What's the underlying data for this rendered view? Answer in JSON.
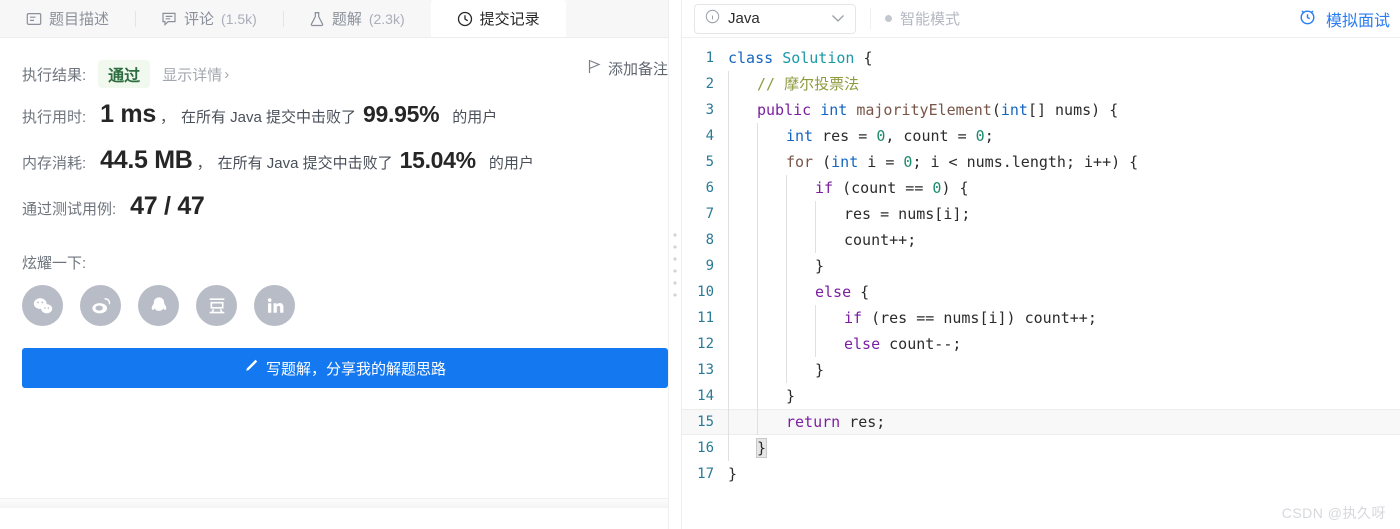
{
  "tabs": [
    {
      "label": "题目描述",
      "count": "",
      "icon": "description-icon",
      "active": false
    },
    {
      "label": "评论",
      "count": "(1.5k)",
      "icon": "comment-icon",
      "active": false
    },
    {
      "label": "题解",
      "count": "(2.3k)",
      "icon": "flask-icon",
      "active": false
    },
    {
      "label": "提交记录",
      "count": "",
      "icon": "clock-icon",
      "active": true
    }
  ],
  "result": {
    "label": "执行结果:",
    "status": "通过",
    "details_link": "显示详情",
    "details_chevron": "›",
    "note_button": "添加备注"
  },
  "runtime": {
    "label": "执行用时:",
    "value": "1 ms",
    "comma": "，",
    "prefix": "在所有 Java 提交中击败了",
    "percent": "99.95%",
    "suffix": "的用户"
  },
  "memory": {
    "label": "内存消耗:",
    "value": "44.5 MB",
    "comma": "，",
    "prefix": "在所有 Java 提交中击败了",
    "percent": "15.04%",
    "suffix": "的用户"
  },
  "testcases": {
    "label": "通过测试用例:",
    "value": "47 / 47"
  },
  "share": {
    "label": "炫耀一下:",
    "items": [
      {
        "name": "wechat-share-icon",
        "glyph": "微"
      },
      {
        "name": "weibo-share-icon",
        "glyph": "博"
      },
      {
        "name": "qq-share-icon",
        "glyph": "Q"
      },
      {
        "name": "douban-share-icon",
        "glyph": "豆"
      },
      {
        "name": "linkedin-share-icon",
        "glyph": "in"
      }
    ]
  },
  "write_solution_button": "写题解，分享我的解题思路",
  "editor": {
    "language": "Java",
    "smart_mode": "智能模式",
    "mock_interview": "模拟面试",
    "chevron": "⌄",
    "active_line": 15,
    "lines": [
      {
        "n": "1",
        "indent": 0,
        "tokens": [
          {
            "t": "class ",
            "c": "kw2"
          },
          {
            "t": "Solution",
            "c": "typ"
          },
          {
            "t": " {",
            "c": "plain"
          }
        ]
      },
      {
        "n": "2",
        "indent": 1,
        "tokens": [
          {
            "t": "// 摩尔投票法",
            "c": "cmt"
          }
        ]
      },
      {
        "n": "3",
        "indent": 1,
        "tokens": [
          {
            "t": "public",
            "c": "kw"
          },
          {
            "t": " ",
            "c": "plain"
          },
          {
            "t": "int",
            "c": "kw2"
          },
          {
            "t": " ",
            "c": "plain"
          },
          {
            "t": "majorityElement",
            "c": "fn"
          },
          {
            "t": "(",
            "c": "plain"
          },
          {
            "t": "int",
            "c": "kw2"
          },
          {
            "t": "[] nums) ",
            "c": "plain"
          },
          {
            "t": "{",
            "c": "plain"
          }
        ]
      },
      {
        "n": "4",
        "indent": 2,
        "tokens": [
          {
            "t": "int",
            "c": "kw2"
          },
          {
            "t": " res = ",
            "c": "plain"
          },
          {
            "t": "0",
            "c": "num"
          },
          {
            "t": ", count = ",
            "c": "plain"
          },
          {
            "t": "0",
            "c": "num"
          },
          {
            "t": ";",
            "c": "plain"
          }
        ]
      },
      {
        "n": "5",
        "indent": 2,
        "tokens": [
          {
            "t": "for",
            "c": "fn"
          },
          {
            "t": " (",
            "c": "plain"
          },
          {
            "t": "int",
            "c": "kw2"
          },
          {
            "t": " i = ",
            "c": "plain"
          },
          {
            "t": "0",
            "c": "num"
          },
          {
            "t": "; i < nums.length; i++) {",
            "c": "plain"
          }
        ]
      },
      {
        "n": "6",
        "indent": 3,
        "tokens": [
          {
            "t": "if",
            "c": "kw"
          },
          {
            "t": " (count == ",
            "c": "plain"
          },
          {
            "t": "0",
            "c": "num"
          },
          {
            "t": ") {",
            "c": "plain"
          }
        ]
      },
      {
        "n": "7",
        "indent": 4,
        "tokens": [
          {
            "t": "res = nums[i];",
            "c": "plain"
          }
        ]
      },
      {
        "n": "8",
        "indent": 4,
        "tokens": [
          {
            "t": "count++;",
            "c": "plain"
          }
        ]
      },
      {
        "n": "9",
        "indent": 3,
        "tokens": [
          {
            "t": "}",
            "c": "plain"
          }
        ]
      },
      {
        "n": "10",
        "indent": 3,
        "tokens": [
          {
            "t": "else",
            "c": "kw"
          },
          {
            "t": " {",
            "c": "plain"
          }
        ]
      },
      {
        "n": "11",
        "indent": 4,
        "tokens": [
          {
            "t": "if",
            "c": "kw"
          },
          {
            "t": " (res == nums[i]) count++;",
            "c": "plain"
          }
        ]
      },
      {
        "n": "12",
        "indent": 4,
        "tokens": [
          {
            "t": "else",
            "c": "kw"
          },
          {
            "t": " count--;",
            "c": "plain"
          }
        ]
      },
      {
        "n": "13",
        "indent": 3,
        "tokens": [
          {
            "t": "}",
            "c": "plain"
          }
        ]
      },
      {
        "n": "14",
        "indent": 2,
        "tokens": [
          {
            "t": "}",
            "c": "plain"
          }
        ]
      },
      {
        "n": "15",
        "indent": 2,
        "tokens": [
          {
            "t": "return",
            "c": "kw"
          },
          {
            "t": " res;",
            "c": "plain"
          }
        ]
      },
      {
        "n": "16",
        "indent": 1,
        "tokens": [
          {
            "t": "}",
            "c": "plain bracket-match"
          }
        ]
      },
      {
        "n": "17",
        "indent": 0,
        "tokens": [
          {
            "t": "}",
            "c": "plain"
          }
        ]
      }
    ]
  },
  "watermark": "CSDN @执久呀",
  "colors": {
    "accent_blue": "#1478f0",
    "pass_green": "#2c6e3f",
    "pass_bg": "#f1f8ee",
    "keyword_purple": "#7b1fa2",
    "type_teal": "#1a9aa8",
    "comment_olive": "#8f9a3d",
    "linenum_blue": "#2a7a96"
  }
}
